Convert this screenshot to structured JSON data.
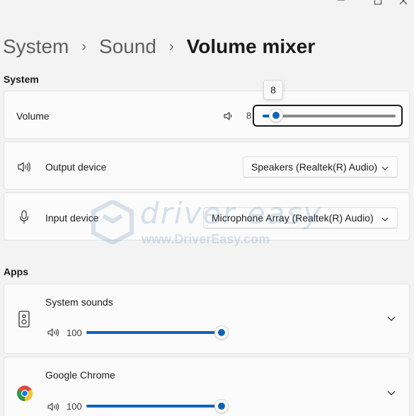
{
  "window": {
    "min_icon": "minimize-icon",
    "max_icon": "maximize-icon",
    "close_icon": "close-icon"
  },
  "breadcrumb": {
    "items": [
      "System",
      "Sound",
      "Volume mixer"
    ],
    "separator": "›"
  },
  "system_section": {
    "label": "System",
    "volume": {
      "label": "Volume",
      "value": "8",
      "tooltip": "8",
      "level_percent": 8,
      "icon": "speaker-icon"
    },
    "output": {
      "label": "Output device",
      "selected": "Speakers (Realtek(R) Audio)",
      "icon": "speaker-loud-icon"
    },
    "input": {
      "label": "Input device",
      "selected": "Microphone Array (Realtek(R) Audio)",
      "icon": "microphone-icon"
    }
  },
  "apps_section": {
    "label": "Apps",
    "apps": [
      {
        "name": "System Sounds",
        "display": "System sounds",
        "volume": "100",
        "level_percent": 100,
        "icon": "system-sounds-icon"
      },
      {
        "name": "Google Chrome",
        "display": "Google Chrome",
        "volume": "100",
        "level_percent": 100,
        "icon": "chrome-icon"
      }
    ]
  },
  "watermark": {
    "brand": "driver easy",
    "url": "www.DriverEasy.com"
  },
  "colors": {
    "accent": "#0f63b8",
    "background": "#f3f3f3",
    "card": "#fbfbfb"
  }
}
